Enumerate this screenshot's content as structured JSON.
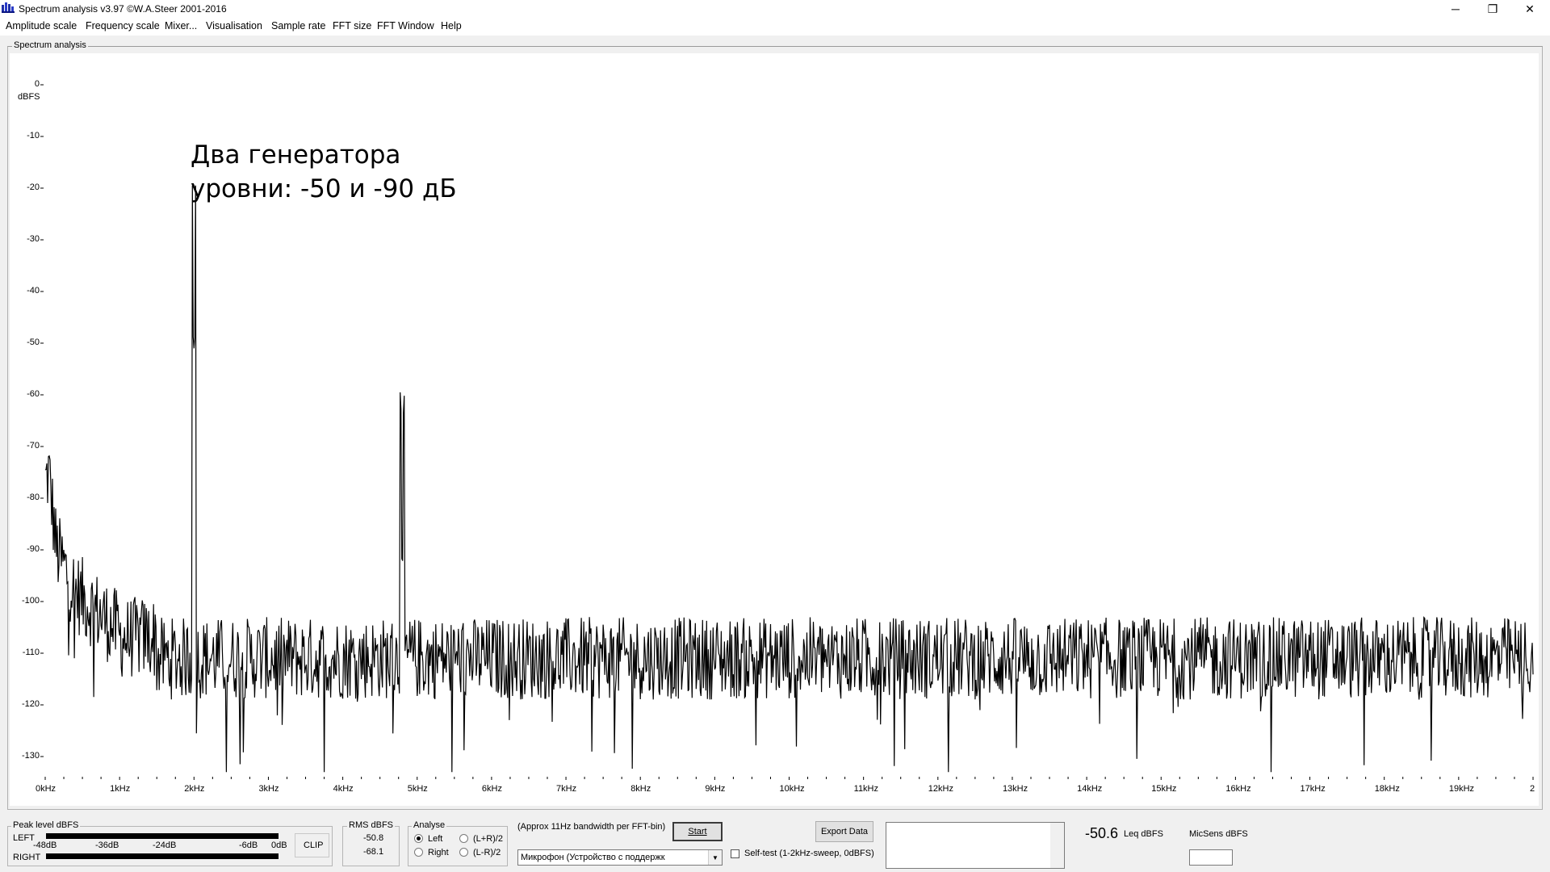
{
  "window": {
    "title": "Spectrum analysis v3.97  ©W.A.Steer 2001-2016",
    "minimize_symbol": "─",
    "maximize_symbol": "❐",
    "close_symbol": "✕"
  },
  "menu": {
    "items": [
      "Amplitude scale",
      "Frequency scale",
      "Mixer...",
      "Visualisation",
      "Sample rate",
      "FFT size",
      "FFT Window",
      "Help"
    ]
  },
  "plot": {
    "frame_label": "Spectrum analysis",
    "y_unit": "dBFS",
    "annotation": [
      "Два генератора",
      "уровни: -50 и -90 дБ"
    ]
  },
  "chart_data": {
    "type": "line",
    "title": "",
    "ylabel": "dBFS",
    "xlabel": "",
    "ylim": [
      -135,
      0
    ],
    "xlim_khz": [
      0,
      20
    ],
    "grid": false,
    "y_ticks": [
      0,
      -10,
      -20,
      -30,
      -40,
      -50,
      -60,
      -70,
      -80,
      -90,
      -100,
      -110,
      -120,
      -130
    ],
    "y_tick_labels": [
      "0",
      "-10",
      "-20",
      "-30",
      "-40",
      "-50",
      "-60",
      "-70",
      "-80",
      "-90",
      "-100",
      "-110",
      "-120",
      "-130"
    ],
    "x_ticks_khz": [
      0,
      1,
      2,
      3,
      4,
      5,
      6,
      7,
      8,
      9,
      10,
      11,
      12,
      13,
      14,
      15,
      16,
      17,
      18,
      19,
      20
    ],
    "x_tick_labels": [
      "0kHz",
      "1kHz",
      "2kHz",
      "3kHz",
      "4kHz",
      "5kHz",
      "6kHz",
      "7kHz",
      "8kHz",
      "9kHz",
      "10kHz",
      "11kHz",
      "12kHz",
      "13kHz",
      "14kHz",
      "15kHz",
      "16kHz",
      "17kHz",
      "18kHz",
      "19kHz",
      "2"
    ],
    "series": [
      {
        "peaks": [
          {
            "x_khz": 2.0,
            "y": -51
          },
          {
            "x_khz": 4.8,
            "y": -93
          }
        ],
        "noise_floor_db": -111,
        "noise_spread_db": 8,
        "low_freq_level_db": [
          {
            "x_khz": 0.0,
            "y": -77
          },
          {
            "x_khz": 0.05,
            "y": -75
          },
          {
            "x_khz": 0.15,
            "y": -90
          },
          {
            "x_khz": 0.4,
            "y": -98
          },
          {
            "x_khz": 1.0,
            "y": -106
          }
        ]
      }
    ]
  },
  "bottom": {
    "peak_group_label": "Peak level dBFS",
    "left_label": "LEFT",
    "right_label": "RIGHT",
    "scale_labels": [
      "-48dB",
      "-36dB",
      "-24dB",
      "-6dB",
      "0dB"
    ],
    "clip_label": "CLIP",
    "rms_group_label": "RMS dBFS",
    "rms_left": "-50.8",
    "rms_right": "-68.1",
    "analyse_group_label": "Analyse",
    "analyse_left": "Left",
    "analyse_right": "Right",
    "analyse_sum": "(L+R)/2",
    "analyse_diff": "(L-R)/2",
    "bandwidth_note": "(Approx 11Hz bandwidth per FFT-bin)",
    "start_label": "Start",
    "device_value": "Микрофон (Устройство с поддержк",
    "export_label": "Export Data",
    "selftest_label": "Self-test  (1-2kHz-sweep, 0dBFS)",
    "leq_value": "-50.6",
    "leq_unit": "Leq dBFS",
    "micsens_label": "MicSens dBFS"
  }
}
